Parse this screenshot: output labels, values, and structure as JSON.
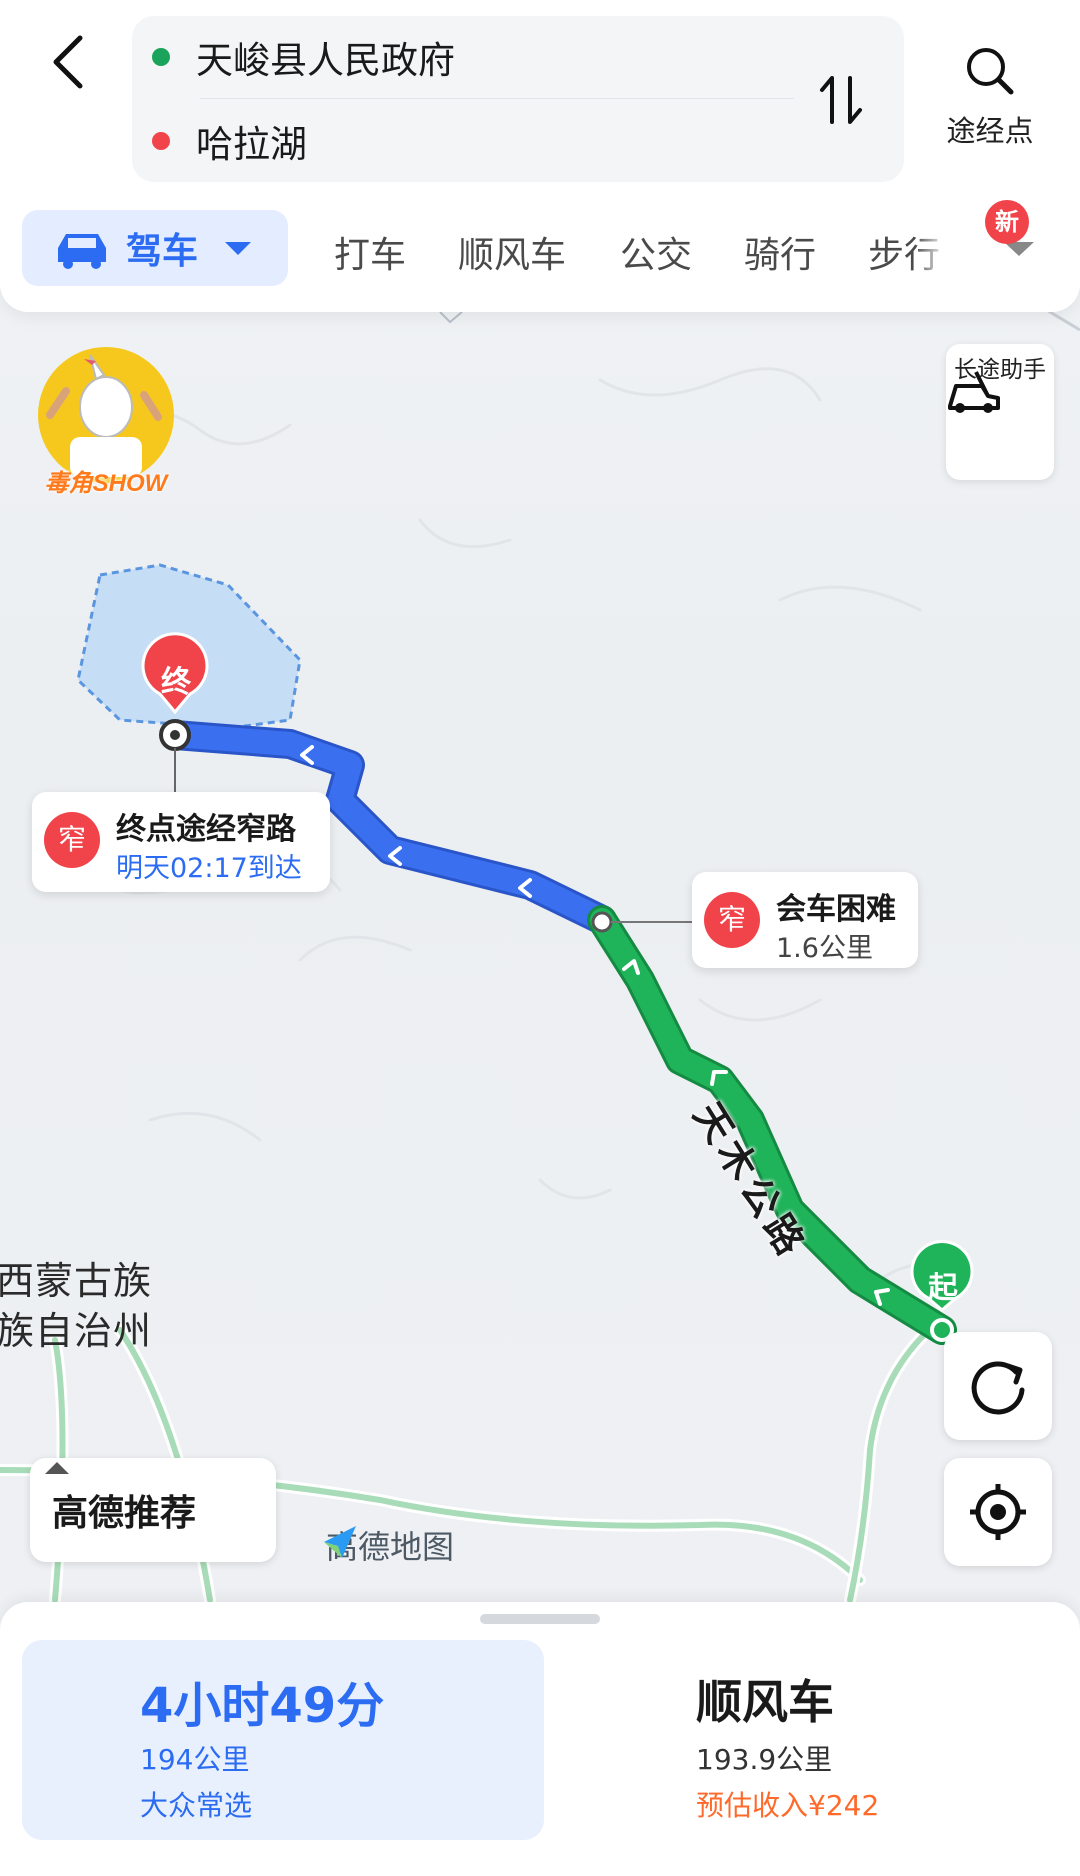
{
  "header": {
    "origin": "天峻县人民政府",
    "destination": "哈拉湖",
    "waypoint_label": "途经点",
    "origin_color": "#1aa35a",
    "destination_color": "#f1434a"
  },
  "tabs": {
    "drive": "驾车",
    "taxi": "打车",
    "carpool": "顺风车",
    "transit": "公交",
    "cycling": "骑行",
    "walk": "步行",
    "new_badge": "新"
  },
  "map": {
    "long_trip_label": "长途助手",
    "avatar_brand": "毒角SHOW",
    "end_marker": "终",
    "start_marker": "起",
    "end_callout": {
      "icon": "窄",
      "title": "终点途经窄路",
      "subtitle": "明天02:17到达"
    },
    "narrow_callout": {
      "icon": "窄",
      "title": "会车困难",
      "subtitle": "1.6公里"
    },
    "road_name": "天木公路",
    "region_label_line1": "西蒙古族",
    "region_label_line2": "族自治州",
    "recommend_button": "高德推荐",
    "watermark": "高德地图"
  },
  "routes": {
    "primary": {
      "duration": "4小时49分",
      "distance": "194公里",
      "tag": "大众常选"
    },
    "carpool": {
      "title": "顺风车",
      "distance": "193.9公里",
      "income": "预估收入¥242"
    }
  },
  "colors": {
    "accent": "#2b6cf2",
    "route_blue": "#3a6ff0",
    "route_green": "#1fb35a",
    "danger": "#f1434a",
    "income": "#ff6a2b"
  }
}
